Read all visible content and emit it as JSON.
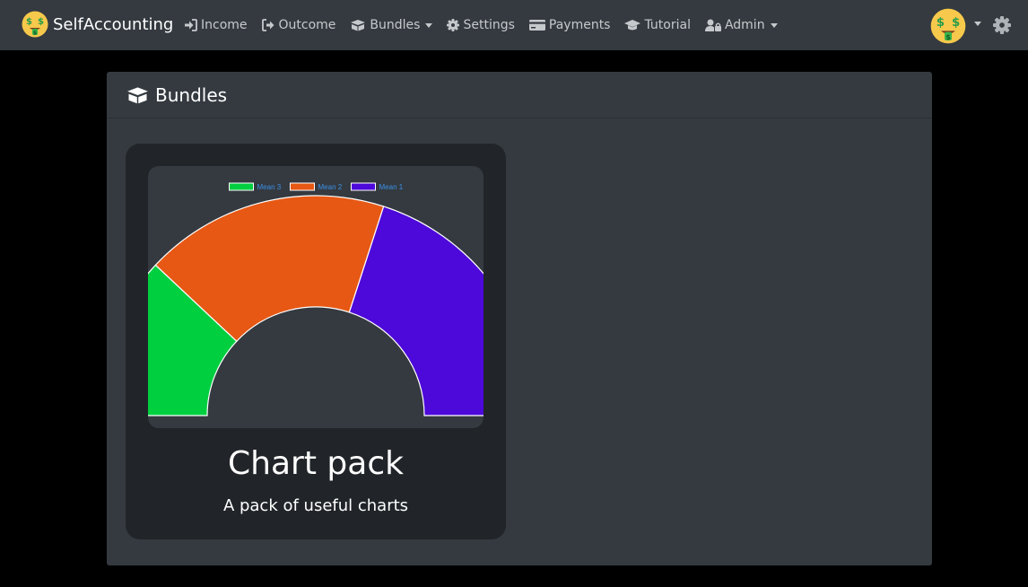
{
  "nav": {
    "brand": "SelfAccounting",
    "items": [
      {
        "label": "Income",
        "icon": "sign-in-icon",
        "dropdown": false
      },
      {
        "label": "Outcome",
        "icon": "sign-out-icon",
        "dropdown": false
      },
      {
        "label": "Bundles",
        "icon": "boxes-icon",
        "dropdown": true
      },
      {
        "label": "Settings",
        "icon": "gear-icon",
        "dropdown": false
      },
      {
        "label": "Payments",
        "icon": "credit-card-icon",
        "dropdown": false
      },
      {
        "label": "Tutorial",
        "icon": "graduation-cap-icon",
        "dropdown": false
      },
      {
        "label": "Admin",
        "icon": "user-lock-icon",
        "dropdown": true
      }
    ]
  },
  "page": {
    "title": "Bundles"
  },
  "bundle": {
    "title": "Chart pack",
    "description": "A pack of useful charts"
  },
  "chart_data": {
    "type": "pie",
    "variant": "half-doughnut",
    "series": [
      {
        "name": "Mean 3",
        "value": 24,
        "color": "#00cf40"
      },
      {
        "name": "Mean 2",
        "value": 36,
        "color": "#e65814"
      },
      {
        "name": "Mean 1",
        "value": 40,
        "color": "#4d08da"
      }
    ],
    "legend": "top"
  },
  "colors": {
    "navbar": "#343a40",
    "background": "#000000",
    "tile": "#212529",
    "legend_text": "#3b8fe6"
  }
}
